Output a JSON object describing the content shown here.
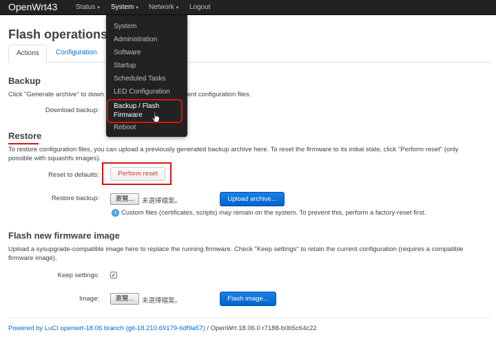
{
  "navbar": {
    "brand": "OpenWrt43",
    "menus": [
      "Status",
      "System",
      "Network",
      "Logout"
    ],
    "caret": "▾"
  },
  "system_menu": {
    "items": [
      "System",
      "Administration",
      "Software",
      "Startup",
      "Scheduled Tasks",
      "LED Configuration",
      "Backup / Flash Firmware",
      "Reboot"
    ],
    "highlighted": "Backup / Flash Firmware"
  },
  "page": {
    "title": "Flash operations",
    "tabs": [
      "Actions",
      "Configuration"
    ],
    "active_tab": "Actions"
  },
  "backup": {
    "heading": "Backup",
    "description_left": "Click \"Generate archive\" to down",
    "description_right": "ent configuration files.",
    "download_label": "Download backup:"
  },
  "restore": {
    "heading": "Restore",
    "description": "To restore configuration files, you can upload a previously generated backup archive here. To reset the firmware to its initial state, click \"Perform reset\" (only possible with squashfs images).",
    "reset_label": "Reset to defaults:",
    "reset_button": "Perform reset",
    "restore_label": "Restore backup:",
    "browse_button": "瀏覽...",
    "no_file": "未選擇檔案。",
    "upload_button": "Upload archive...",
    "info_text": "Custom files (certificates, scripts) may remain on the system. To prevent this, perform a factory-reset first."
  },
  "flash": {
    "heading": "Flash new firmware image",
    "description": "Upload a sysupgrade-compatible image here to replace the running firmware. Check \"Keep settings\" to retain the current configuration (requires a compatible firmware image).",
    "keep_label": "Keep settings:",
    "keep_checked": true,
    "image_label": "Image:",
    "browse_button": "瀏覽...",
    "no_file": "未選擇檔案。",
    "flash_button": "Flash image..."
  },
  "footer": {
    "link_text": "Powered by LuCI openwrt-18.06 branch (git-18.210.69179-6df9a57)",
    "separator": " / ",
    "version": "OpenWrt 18.06.0 r7188-b0b5c64c22"
  },
  "colors": {
    "navbar": "#222222",
    "accent": "#0069d6",
    "highlight": "#e01010",
    "primary_button": "#0064cd"
  },
  "icons": {
    "info": "info-circle-icon",
    "cursor": "hand-pointer-icon",
    "checkmark": "✓",
    "info_glyph": "i"
  }
}
